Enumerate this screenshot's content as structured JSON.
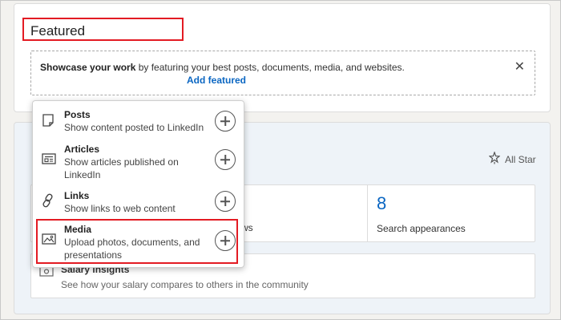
{
  "featured": {
    "title": "Featured",
    "showcase_bold": "Showcase your work",
    "showcase_rest": " by featuring your best posts, documents, media, and websites.",
    "add_label": "Add featured",
    "close_glyph": "✕"
  },
  "menu": {
    "items": [
      {
        "title": "Posts",
        "desc": "Show content posted to LinkedIn",
        "icon": "note-icon"
      },
      {
        "title": "Articles",
        "desc": "Show articles published on LinkedIn",
        "icon": "article-icon"
      },
      {
        "title": "Links",
        "desc": "Show links to web content",
        "icon": "link-icon"
      },
      {
        "title": "Media",
        "desc": "Upload photos, documents, and presentations",
        "icon": "image-icon"
      }
    ]
  },
  "lower": {
    "all_star": "All Star",
    "stat_partial": "ws",
    "search_count": "8",
    "search_label": "Search appearances",
    "salary_title": "Salary insights",
    "salary_sub": "See how your salary compares to others in the community"
  },
  "colors": {
    "accent": "#0a66c2",
    "highlight": "#e31b23"
  }
}
